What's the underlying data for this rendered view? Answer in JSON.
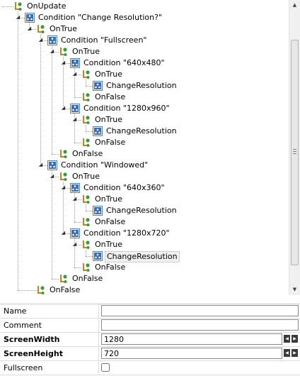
{
  "tree": {
    "nodes": [
      {
        "label": "OnUpdate",
        "icon": "event-handler-icon",
        "selected": false
      },
      {
        "label": "Condition \"Change Resolution?\"",
        "icon": "condition-icon",
        "selected": false
      },
      {
        "label": "OnTrue",
        "icon": "event-handler-icon",
        "selected": false
      },
      {
        "label": "Condition \"Fullscreen\"",
        "icon": "condition-icon",
        "selected": false
      },
      {
        "label": "OnTrue",
        "icon": "event-handler-icon",
        "selected": false
      },
      {
        "label": "Condition \"640x480\"",
        "icon": "condition-icon",
        "selected": false
      },
      {
        "label": "OnTrue",
        "icon": "event-handler-icon",
        "selected": false
      },
      {
        "label": "ChangeResolution",
        "icon": "action-icon",
        "selected": false
      },
      {
        "label": "OnFalse",
        "icon": "event-handler-icon",
        "selected": false
      },
      {
        "label": "Condition \"1280x960\"",
        "icon": "condition-icon",
        "selected": false
      },
      {
        "label": "OnTrue",
        "icon": "event-handler-icon",
        "selected": false
      },
      {
        "label": "ChangeResolution",
        "icon": "action-icon",
        "selected": false
      },
      {
        "label": "OnFalse",
        "icon": "event-handler-icon",
        "selected": false
      },
      {
        "label": "OnFalse",
        "icon": "event-handler-icon",
        "selected": false
      },
      {
        "label": "Condition \"Windowed\"",
        "icon": "condition-icon",
        "selected": false
      },
      {
        "label": "OnTrue",
        "icon": "event-handler-icon",
        "selected": false
      },
      {
        "label": "Condition \"640x360\"",
        "icon": "condition-icon",
        "selected": false
      },
      {
        "label": "OnTrue",
        "icon": "event-handler-icon",
        "selected": false
      },
      {
        "label": "ChangeResolution",
        "icon": "action-icon",
        "selected": false
      },
      {
        "label": "OnFalse",
        "icon": "event-handler-icon",
        "selected": false
      },
      {
        "label": "Condition \"1280x720\"",
        "icon": "condition-icon",
        "selected": false
      },
      {
        "label": "OnTrue",
        "icon": "event-handler-icon",
        "selected": false
      },
      {
        "label": "ChangeResolution",
        "icon": "action-icon",
        "selected": true
      },
      {
        "label": "OnFalse",
        "icon": "event-handler-icon",
        "selected": false
      },
      {
        "label": "OnFalse",
        "icon": "event-handler-icon",
        "selected": false
      },
      {
        "label": "OnFalse",
        "icon": "event-handler-icon",
        "selected": false
      }
    ]
  },
  "properties": {
    "name": {
      "label": "Name",
      "value": ""
    },
    "comment": {
      "label": "Comment",
      "value": ""
    },
    "screen_width": {
      "label": "ScreenWidth",
      "value": "1280"
    },
    "screen_height": {
      "label": "ScreenHeight",
      "value": "720"
    },
    "fullscreen": {
      "label": "Fullscreen",
      "checked": false
    }
  },
  "colors": {
    "condition_icon": "#3a6db5",
    "event_leaf_green": "#3b9b3b",
    "event_stem": "#b8862b"
  }
}
